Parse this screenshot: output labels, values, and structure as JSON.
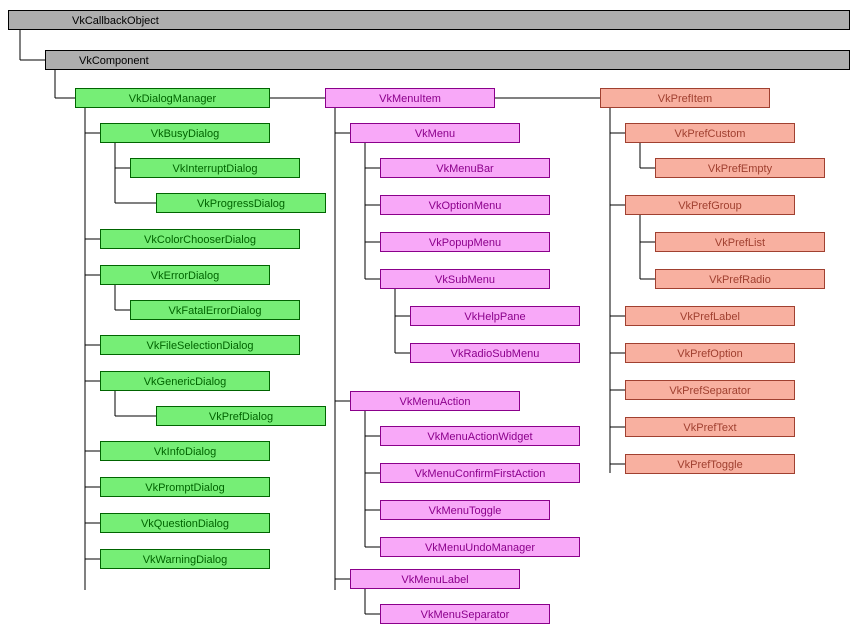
{
  "root": {
    "label": "VkCallbackObject"
  },
  "component": {
    "label": "VkComponent"
  },
  "col1": {
    "head": "VkDialogManager",
    "n1": "VkBusyDialog",
    "n1a": "VkInterruptDialog",
    "n1b": "VkProgressDialog",
    "n2": "VkColorChooserDialog",
    "n3": "VkErrorDialog",
    "n3a": "VkFatalErrorDialog",
    "n4": "VkFileSelectionDialog",
    "n5": "VkGenericDialog",
    "n5a": "VkPrefDialog",
    "n6": "VkInfoDialog",
    "n7": "VkPromptDialog",
    "n8": "VkQuestionDialog",
    "n9": "VkWarningDialog"
  },
  "col2": {
    "head": "VkMenuItem",
    "m1": "VkMenu",
    "m1a": "VkMenuBar",
    "m1b": "VkOptionMenu",
    "m1c": "VkPopupMenu",
    "m1d": "VkSubMenu",
    "m1d1": "VkHelpPane",
    "m1d2": "VkRadioSubMenu",
    "m2": "VkMenuAction",
    "m2a": "VkMenuActionWidget",
    "m2b": "VkMenuConfirmFirstAction",
    "m2c": "VkMenuToggle",
    "m2d": "VkMenuUndoManager",
    "m3": "VkMenuLabel",
    "m3a": "VkMenuSeparator"
  },
  "col3": {
    "head": "VkPrefItem",
    "p1": "VkPrefCustom",
    "p1a": "VkPrefEmpty",
    "p2": "VkPrefGroup",
    "p2a": "VkPrefList",
    "p2b": "VkPrefRadio",
    "p3": "VkPrefLabel",
    "p4": "VkPrefOption",
    "p5": "VkPrefSeparator",
    "p6": "VkPrefText",
    "p7": "VkPrefToggle"
  },
  "chart_data": {
    "type": "tree",
    "title": "",
    "root": {
      "name": "VkCallbackObject",
      "children": [
        {
          "name": "VkComponent",
          "children": [
            {
              "name": "VkDialogManager",
              "children": [
                {
                  "name": "VkBusyDialog",
                  "children": [
                    {
                      "name": "VkInterruptDialog"
                    },
                    {
                      "name": "VkProgressDialog"
                    }
                  ]
                },
                {
                  "name": "VkColorChooserDialog"
                },
                {
                  "name": "VkErrorDialog",
                  "children": [
                    {
                      "name": "VkFatalErrorDialog"
                    }
                  ]
                },
                {
                  "name": "VkFileSelectionDialog"
                },
                {
                  "name": "VkGenericDialog",
                  "children": [
                    {
                      "name": "VkPrefDialog"
                    }
                  ]
                },
                {
                  "name": "VkInfoDialog"
                },
                {
                  "name": "VkPromptDialog"
                },
                {
                  "name": "VkQuestionDialog"
                },
                {
                  "name": "VkWarningDialog"
                }
              ]
            },
            {
              "name": "VkMenuItem",
              "children": [
                {
                  "name": "VkMenu",
                  "children": [
                    {
                      "name": "VkMenuBar"
                    },
                    {
                      "name": "VkOptionMenu"
                    },
                    {
                      "name": "VkPopupMenu"
                    },
                    {
                      "name": "VkSubMenu",
                      "children": [
                        {
                          "name": "VkHelpPane"
                        },
                        {
                          "name": "VkRadioSubMenu"
                        }
                      ]
                    }
                  ]
                },
                {
                  "name": "VkMenuAction",
                  "children": [
                    {
                      "name": "VkMenuActionWidget"
                    },
                    {
                      "name": "VkMenuConfirmFirstAction"
                    },
                    {
                      "name": "VkMenuToggle"
                    },
                    {
                      "name": "VkMenuUndoManager"
                    }
                  ]
                },
                {
                  "name": "VkMenuLabel",
                  "children": [
                    {
                      "name": "VkMenuSeparator"
                    }
                  ]
                }
              ]
            },
            {
              "name": "VkPrefItem",
              "children": [
                {
                  "name": "VkPrefCustom",
                  "children": [
                    {
                      "name": "VkPrefEmpty"
                    }
                  ]
                },
                {
                  "name": "VkPrefGroup",
                  "children": [
                    {
                      "name": "VkPrefList"
                    },
                    {
                      "name": "VkPrefRadio"
                    }
                  ]
                },
                {
                  "name": "VkPrefLabel"
                },
                {
                  "name": "VkPrefOption"
                },
                {
                  "name": "VkPrefSeparator"
                },
                {
                  "name": "VkPrefText"
                },
                {
                  "name": "VkPrefToggle"
                }
              ]
            }
          ]
        }
      ]
    }
  }
}
